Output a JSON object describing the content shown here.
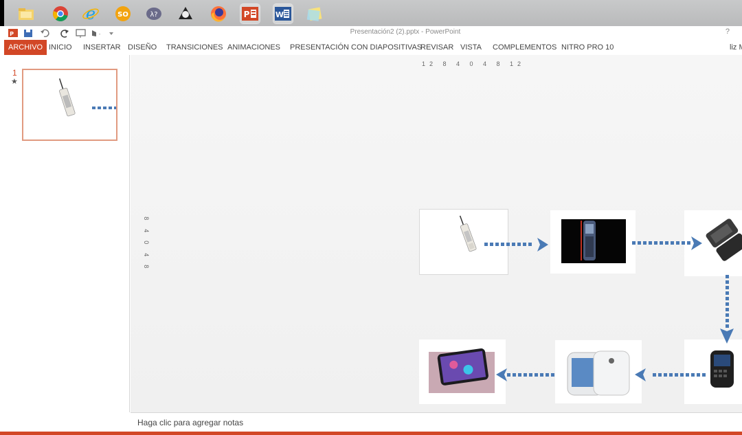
{
  "window": {
    "title": "Presentación2 (2).pptx - PowerPoint",
    "help": "?",
    "user_name": "liz M"
  },
  "taskbar": {
    "icons": [
      "file-explorer-icon",
      "chrome-icon",
      "internet-explorer-icon",
      "stack-overflow-icon",
      "app-icon",
      "app-icon",
      "firefox-icon",
      "powerpoint-icon",
      "word-icon",
      "sticky-notes-icon"
    ],
    "active": "powerpoint-icon"
  },
  "ribbon": {
    "tabs": [
      "ARCHIVO",
      "INICIO",
      "INSERTAR",
      "DISEÑO",
      "TRANSICIONES",
      "ANIMACIONES",
      "PRESENTACIÓN CON DIAPOSITIVAS",
      "REVISAR",
      "VISTA",
      "COMPLEMENTOS",
      "NITRO PRO 10"
    ],
    "active_tab": "ARCHIVO"
  },
  "slides": {
    "thumbs": [
      {
        "number": "1",
        "marker": "★"
      }
    ]
  },
  "rulers": {
    "horizontal": "12 8 4 0 4 8 12",
    "vertical": [
      "8",
      "4",
      "0",
      "4",
      "8"
    ]
  },
  "slide": {
    "images": [
      "brick-phone-image",
      "nokia-phone-image",
      "flip-phone-image",
      "blackberry-phone-image",
      "galaxy-phone-image",
      "iphone-image"
    ],
    "arrow_color": "#4a7ab5"
  },
  "notes": {
    "placeholder": "Haga clic para agregar notas"
  },
  "colors": {
    "accent": "#d24726"
  }
}
